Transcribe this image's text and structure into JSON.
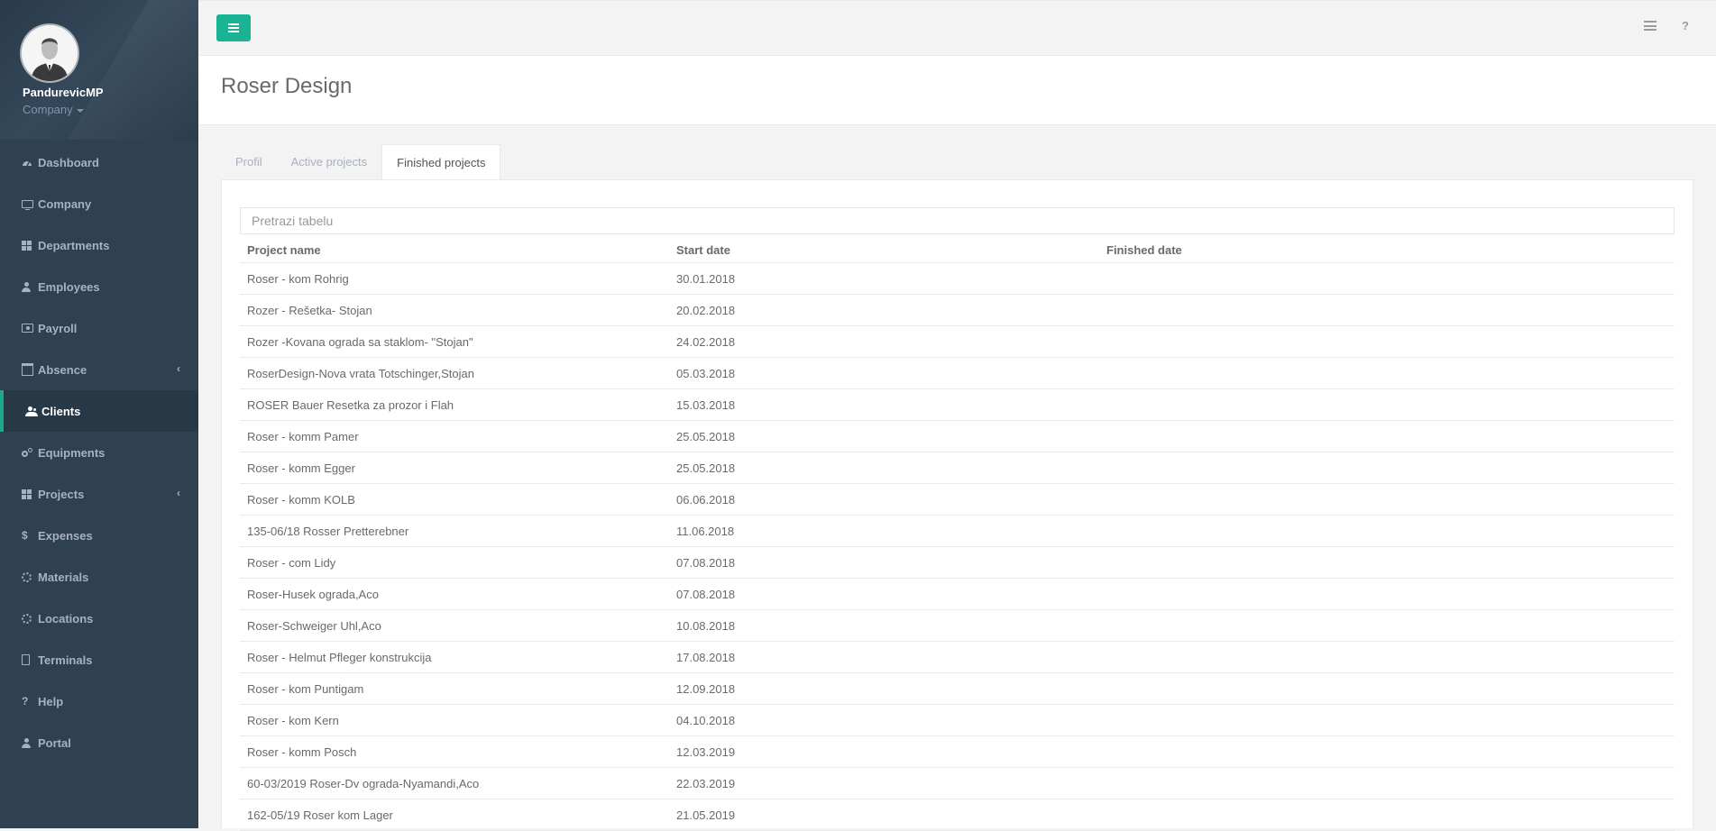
{
  "profile": {
    "name": "PandurevicMP",
    "role": "Company"
  },
  "sidebar": {
    "items": [
      {
        "label": "Dashboard",
        "icon": "dashboard-icon"
      },
      {
        "label": "Company",
        "icon": "monitor-icon"
      },
      {
        "label": "Departments",
        "icon": "grid-icon"
      },
      {
        "label": "Employees",
        "icon": "user-icon"
      },
      {
        "label": "Payroll",
        "icon": "money-icon"
      },
      {
        "label": "Absence",
        "icon": "calendar-icon"
      },
      {
        "label": "Clients",
        "icon": "users-icon"
      },
      {
        "label": "Equipments",
        "icon": "cogs-icon"
      },
      {
        "label": "Projects",
        "icon": "grid-icon"
      },
      {
        "label": "Expenses",
        "icon": "dollar-icon"
      },
      {
        "label": "Materials",
        "icon": "recycle-icon"
      },
      {
        "label": "Locations",
        "icon": "recycle-icon"
      },
      {
        "label": "Terminals",
        "icon": "phone-icon"
      },
      {
        "label": "Help",
        "icon": "question-icon"
      },
      {
        "label": "Portal",
        "icon": "user-icon"
      }
    ],
    "submenu_chevron": "‹",
    "dollar_glyph": "$",
    "question_glyph": "?"
  },
  "topbar": {
    "help_glyph": "?"
  },
  "page": {
    "title": "Roser Design"
  },
  "tabs": [
    {
      "label": "Profil"
    },
    {
      "label": "Active projects"
    },
    {
      "label": "Finished projects"
    }
  ],
  "search": {
    "placeholder": "Pretrazi tabelu",
    "value": ""
  },
  "table": {
    "headers": [
      "Project name",
      "Start date",
      "Finished date"
    ],
    "rows": [
      {
        "name": "Roser - kom Rohrig",
        "start": "30.01.2018",
        "finished": ""
      },
      {
        "name": "Rozer - Rešetka- Stojan",
        "start": "20.02.2018",
        "finished": ""
      },
      {
        "name": "Rozer -Kovana ograda sa staklom- \"Stojan\"",
        "start": "24.02.2018",
        "finished": ""
      },
      {
        "name": "RoserDesign-Nova vrata Totschinger,Stojan",
        "start": "05.03.2018",
        "finished": ""
      },
      {
        "name": "ROSER Bauer Resetka za prozor i Flah",
        "start": "15.03.2018",
        "finished": ""
      },
      {
        "name": "Roser - komm Pamer",
        "start": "25.05.2018",
        "finished": ""
      },
      {
        "name": "Roser - komm Egger",
        "start": "25.05.2018",
        "finished": ""
      },
      {
        "name": "Roser - komm KOLB",
        "start": "06.06.2018",
        "finished": ""
      },
      {
        "name": "135-06/18 Rosser Pretterebner",
        "start": "11.06.2018",
        "finished": ""
      },
      {
        "name": "Roser - com Lidy",
        "start": "07.08.2018",
        "finished": ""
      },
      {
        "name": "Roser-Husek ograda,Aco",
        "start": "07.08.2018",
        "finished": ""
      },
      {
        "name": "Roser-Schweiger Uhl,Aco",
        "start": "10.08.2018",
        "finished": ""
      },
      {
        "name": "Roser - Helmut Pfleger konstrukcija",
        "start": "17.08.2018",
        "finished": ""
      },
      {
        "name": "Roser - kom Puntigam",
        "start": "12.09.2018",
        "finished": ""
      },
      {
        "name": "Roser - kom Kern",
        "start": "04.10.2018",
        "finished": ""
      },
      {
        "name": "Roser - komm Posch",
        "start": "12.03.2019",
        "finished": ""
      },
      {
        "name": "60-03/2019 Roser-Dv ograda-Nyamandi,Aco",
        "start": "22.03.2019",
        "finished": ""
      },
      {
        "name": "162-05/19 Roser kom Lager",
        "start": "21.05.2019",
        "finished": ""
      }
    ]
  },
  "colors": {
    "sidebar": "#2f4050",
    "accent": "#1ab394",
    "active_item": "#293846"
  }
}
